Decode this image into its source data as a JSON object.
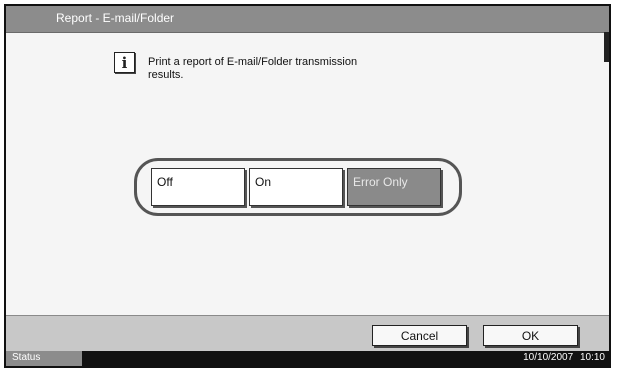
{
  "window": {
    "title": "Report - E-mail/Folder"
  },
  "info": {
    "icon": "info-icon",
    "message": "Print a report of E-mail/Folder transmission results."
  },
  "options": {
    "items": [
      {
        "label": "Off",
        "selected": false
      },
      {
        "label": "On",
        "selected": false
      },
      {
        "label": "Error Only",
        "selected": true
      }
    ]
  },
  "footer": {
    "cancel_label": "Cancel",
    "ok_label": "OK"
  },
  "status_bar": {
    "label": "Status",
    "date": "10/10/2007",
    "time": "10:10"
  }
}
